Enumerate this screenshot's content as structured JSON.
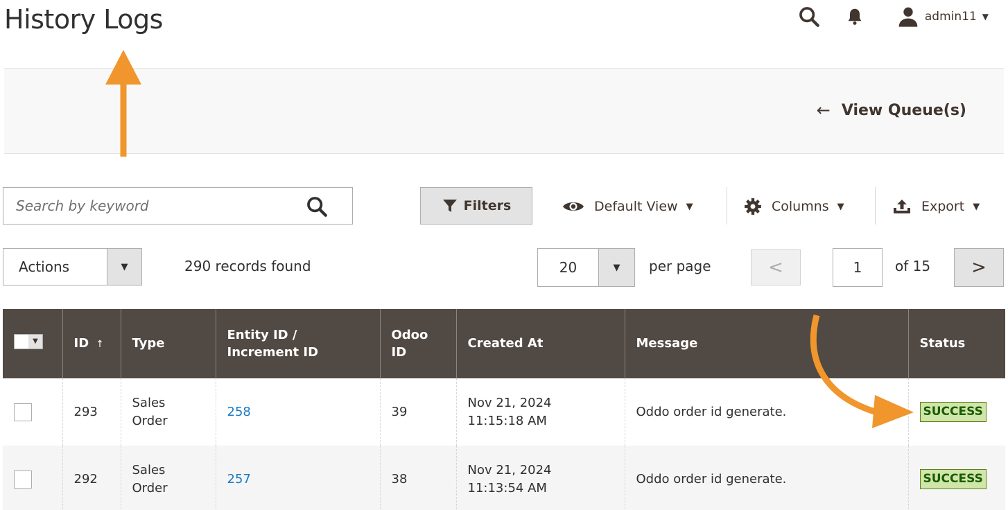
{
  "page": {
    "title": "History Logs"
  },
  "header": {
    "username": "admin11",
    "icons": [
      "search-icon",
      "bell-icon",
      "user-icon"
    ]
  },
  "action_bar": {
    "back_label": "View Queue(s)",
    "back_arrow": "←"
  },
  "toolbar": {
    "search_placeholder": "Search by keyword",
    "filters_label": "Filters",
    "view_label": "Default View",
    "columns_label": "Columns",
    "export_label": "Export"
  },
  "paging": {
    "actions_label": "Actions",
    "records_text": "290 records found",
    "per_page_value": "20",
    "per_page_label": "per page",
    "current_page": "1",
    "of_pages": "of 15",
    "prev_glyph": "<",
    "next_glyph": ">"
  },
  "table": {
    "columns": {
      "id": "ID",
      "sort_glyph": "↑",
      "type": "Type",
      "entity_1": "Entity ID /",
      "entity_2": "Increment ID",
      "odoo_1": "Odoo",
      "odoo_2": "ID",
      "created": "Created At",
      "message": "Message",
      "status": "Status"
    },
    "rows": [
      {
        "id": "293",
        "type_1": "Sales",
        "type_2": "Order",
        "entity": "258",
        "odoo_id": "39",
        "date": "Nov 21, 2024",
        "time": "11:15:18 AM",
        "message": "Oddo order id generate.",
        "status": "SUCCESS"
      },
      {
        "id": "292",
        "type_1": "Sales",
        "type_2": "Order",
        "entity": "257",
        "odoo_id": "38",
        "date": "Nov 21, 2024",
        "time": "11:13:54 AM",
        "message": "Oddo order id generate.",
        "status": "SUCCESS"
      }
    ]
  },
  "colors": {
    "header_bg": "#514943",
    "accent_link": "#1979c3",
    "annotation": "#f0962d",
    "success_bg": "#d0e5a9",
    "success_text": "#185b00"
  }
}
